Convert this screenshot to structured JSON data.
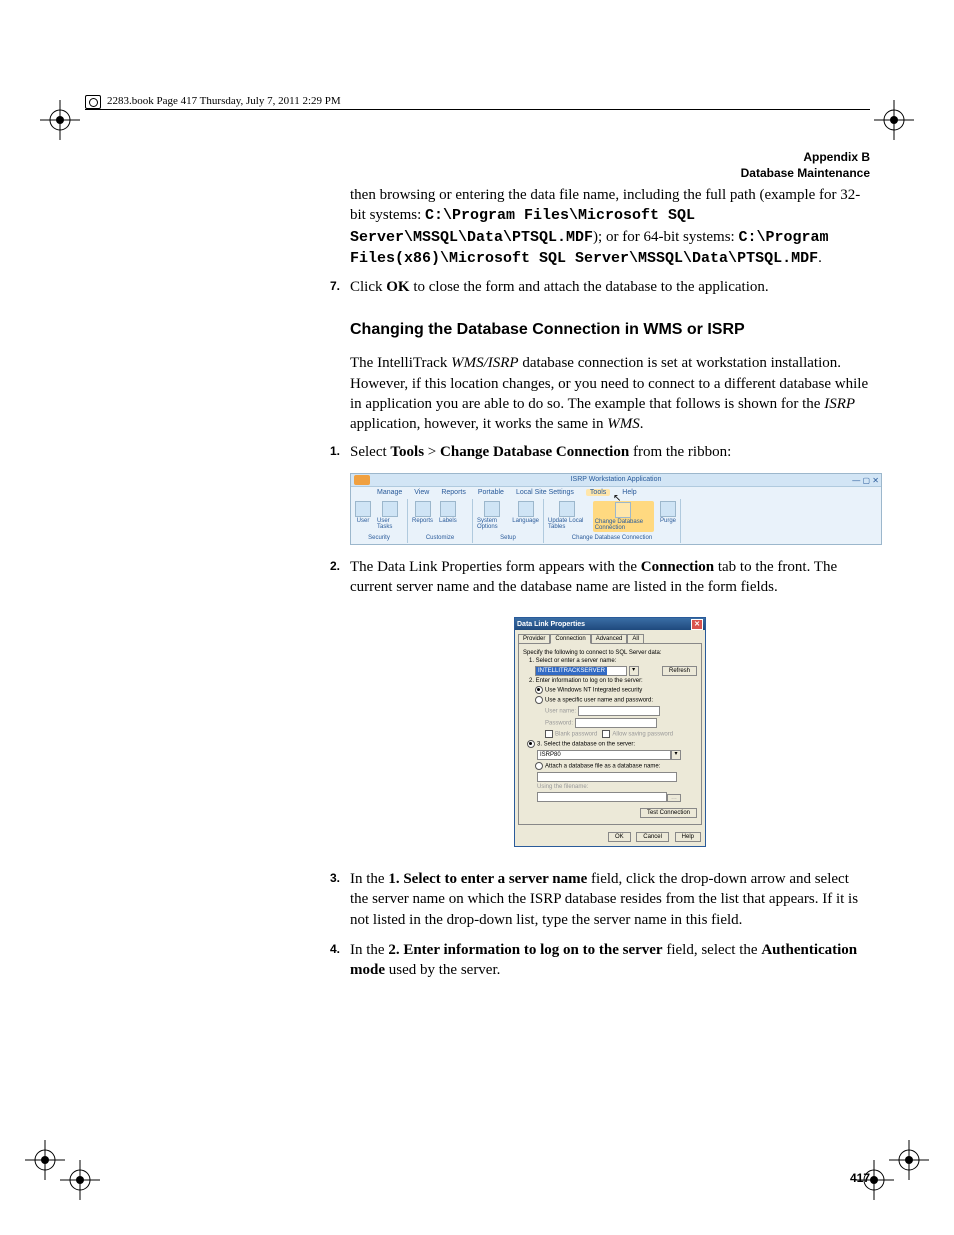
{
  "meta_header": "2283.book  Page 417  Thursday, July 7, 2011  2:29 PM",
  "running_head_line1": "Appendix B",
  "running_head_line2": "Database Maintenance",
  "intro_fragment_a": "then browsing or entering the data file name, including the full path (example for 32-bit systems: ",
  "intro_path32": "C:\\Program Files\\Microsoft SQL Server\\MSSQL\\Data\\PTSQL.MDF",
  "intro_fragment_b": "); or for 64-bit systems: ",
  "intro_path64": "C:\\Program Files(x86)\\Microsoft SQL Server\\MSSQL\\Data\\PTSQL.MDF",
  "intro_fragment_c": ".",
  "step7_num": "7.",
  "step7_a": "Click ",
  "step7_b_bold": "OK",
  "step7_c": " to close the form and attach the database to the application.",
  "section_heading": "Changing the Database Connection in WMS or ISRP",
  "para1_a": "The IntelliTrack ",
  "para1_b_it": "WMS/ISRP",
  "para1_c": " database connection is set at workstation installation. However, if this location changes, or you need to connect to a different database while in application you are able to do so. The example that follows is shown for the ",
  "para1_d_it": "ISRP",
  "para1_e": " application, however, it works the same in ",
  "para1_f_it": "WMS",
  "para1_g": ".",
  "s1_num": "1.",
  "s1_a": "Select ",
  "s1_b_bold": "Tools",
  "s1_c": " > ",
  "s1_d_bold": "Change Database Connection",
  "s1_e": " from the ribbon:",
  "ribbon": {
    "title": "ISRP Workstation Application",
    "tabs": [
      "Manage",
      "View",
      "Reports",
      "Portable",
      "Local Site Settings",
      "Tools",
      "Help"
    ],
    "groups": {
      "security": {
        "items": [
          "User",
          "User Tasks"
        ],
        "label": "Security"
      },
      "customize": {
        "items": [
          "Reports",
          "Labels"
        ],
        "label": "Customize"
      },
      "setup": {
        "items": [
          "System Options",
          "Language"
        ],
        "label": "Setup"
      },
      "cdc": {
        "items": [
          "Update Local Tables",
          "Change Database Connection",
          "Purge"
        ],
        "label": "Change Database Connection"
      }
    }
  },
  "s2_num": "2.",
  "s2_a": "The Data Link Properties form appears with the ",
  "s2_b_bold": "Connection",
  "s2_c": " tab to the front. The current server name and the database name are listed in the form fields.",
  "dialog": {
    "title": "Data Link Properties",
    "tabs": [
      "Provider",
      "Connection",
      "Advanced",
      "All"
    ],
    "instruction": "Specify the following to connect to SQL Server data:",
    "row1_label": "1. Select or enter a server name:",
    "row1_value": "INTELLITRACKSERVER",
    "refresh": "Refresh",
    "row2_label": "2. Enter information to log on to the server:",
    "row2_opt1": "Use Windows NT Integrated security",
    "row2_opt2": "Use a specific user name and password:",
    "username_label": "User name:",
    "password_label": "Password:",
    "blank_pw": "Blank password",
    "allow_saving": "Allow saving password",
    "row3_opt1": "3.    Select the database on the server:",
    "row3_value": "ISRP80",
    "row3_opt2": "Attach a database file as a database name:",
    "using_filename": "Using the filename:",
    "test_connection": "Test Connection",
    "ok": "OK",
    "cancel": "Cancel",
    "help": "Help"
  },
  "s3_num": "3.",
  "s3_a": "In the ",
  "s3_b_bold": "1. Select to enter a server name",
  "s3_c": " field, click the drop-down arrow and select the server name on which the ISRP database resides from the list that appears. If it is not listed in the drop-down list, type the server name in this field.",
  "s4_num": "4.",
  "s4_a": "In the ",
  "s4_b_bold": "2. Enter information to log on to the server",
  "s4_c": " field, select the ",
  "s4_d_bold": "Authentication mode",
  "s4_e": " used by the server.",
  "page_number": "417"
}
